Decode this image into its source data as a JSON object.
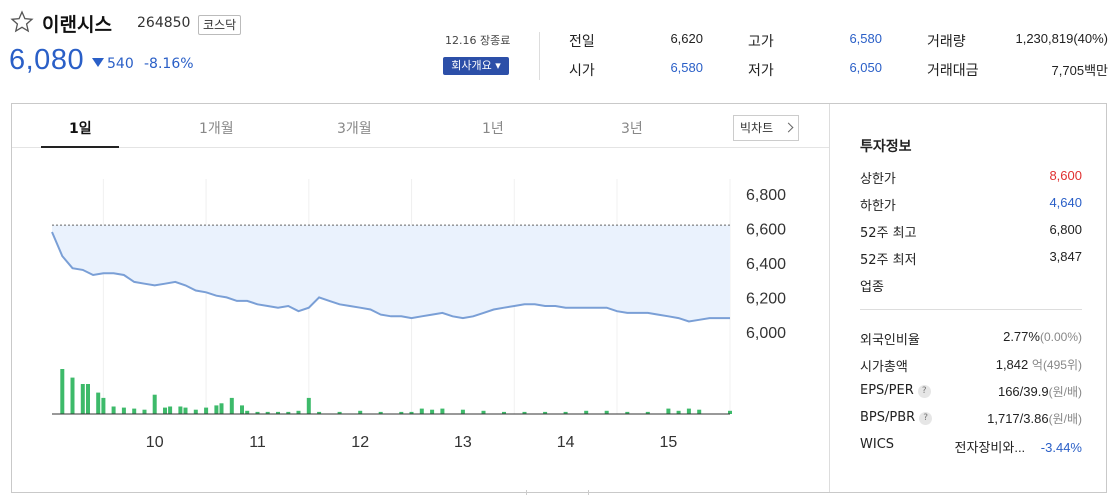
{
  "stock": {
    "name": "이랜시스",
    "code": "264850",
    "market": "코스닥",
    "price": "6,080",
    "change": "540",
    "change_rate": "-8.16%",
    "close_time": "12.16 장종료",
    "company_btn": "회사개요 ▾"
  },
  "quote": {
    "prev_label": "전일",
    "prev": "6,620",
    "high_label": "고가",
    "high": "6,580",
    "volume_label": "거래량",
    "volume": "1,230,819(40%)",
    "open_label": "시가",
    "open": "6,580",
    "low_label": "저가",
    "low": "6,050",
    "amount_label": "거래대금",
    "amount": "7,705백만"
  },
  "tabs": [
    "1일",
    "1개월",
    "3개월",
    "1년",
    "3년"
  ],
  "bigchart_label": "빅차트",
  "invest": {
    "title": "투자정보",
    "upper_label": "상한가",
    "upper": "8,600",
    "lower_label": "하한가",
    "lower": "4,640",
    "w52_high_label": "52주 최고",
    "w52_high": "6,800",
    "w52_low_label": "52주 최저",
    "w52_low": "3,847",
    "sector_label": "업종",
    "foreign_label": "외국인비율",
    "foreign": "2.77%",
    "foreign_sub": "(0.00%)",
    "mcap_label": "시가총액",
    "mcap": "1,842",
    "mcap_unit": "억",
    "mcap_sub": "(495위)",
    "eps_label": "EPS/PER",
    "eps": "166/39.9",
    "eps_unit": "(원/배)",
    "bps_label": "BPS/PBR",
    "bps": "1,717/3.86",
    "bps_unit": "(원/배)",
    "wics_label": "WICS",
    "wics": "전자장비와...",
    "wics_rate": "-3.44%",
    "help": "?"
  },
  "colors": {
    "up": "#e03030",
    "down": "#2a5fc7",
    "volume": "#3dba6a",
    "line": "#7a9fd6",
    "fill": "#eaf2fd"
  },
  "chart_data": {
    "type": "line",
    "y_ticks": [
      "6,800",
      "6,600",
      "6,400",
      "6,200",
      "6,000"
    ],
    "x_ticks": [
      "10",
      "11",
      "12",
      "13",
      "14",
      "15"
    ],
    "ylim": [
      5970,
      6830
    ],
    "prev_close": 6620,
    "price_t": [
      9.0,
      9.1,
      9.2,
      9.3,
      9.4,
      9.5,
      9.6,
      9.7,
      9.8,
      9.9,
      10.0,
      10.1,
      10.2,
      10.3,
      10.4,
      10.5,
      10.6,
      10.7,
      10.8,
      10.9,
      11.0,
      11.1,
      11.2,
      11.3,
      11.4,
      11.5,
      11.6,
      11.7,
      11.8,
      11.9,
      12.0,
      12.1,
      12.2,
      12.3,
      12.4,
      12.5,
      12.6,
      12.7,
      12.8,
      12.9,
      13.0,
      13.1,
      13.2,
      13.3,
      13.4,
      13.5,
      13.6,
      13.7,
      13.8,
      13.9,
      14.0,
      14.1,
      14.2,
      14.3,
      14.4,
      14.5,
      14.6,
      14.7,
      14.8,
      14.9,
      15.0,
      15.1,
      15.2,
      15.3,
      15.4,
      15.5,
      15.6
    ],
    "price": [
      6580,
      6440,
      6370,
      6360,
      6330,
      6340,
      6340,
      6330,
      6290,
      6280,
      6270,
      6280,
      6290,
      6270,
      6240,
      6230,
      6210,
      6200,
      6180,
      6180,
      6160,
      6150,
      6140,
      6150,
      6120,
      6140,
      6200,
      6180,
      6160,
      6150,
      6140,
      6130,
      6100,
      6090,
      6090,
      6080,
      6090,
      6100,
      6110,
      6090,
      6080,
      6090,
      6110,
      6130,
      6140,
      6150,
      6160,
      6160,
      6150,
      6150,
      6140,
      6140,
      6140,
      6140,
      6140,
      6120,
      6110,
      6110,
      6110,
      6100,
      6090,
      6080,
      6060,
      6070,
      6080,
      6080,
      6080
    ],
    "vol_t": [
      9.1,
      9.2,
      9.3,
      9.35,
      9.45,
      9.5,
      9.6,
      9.7,
      9.8,
      9.9,
      10.0,
      10.1,
      10.15,
      10.25,
      10.3,
      10.4,
      10.5,
      10.6,
      10.65,
      10.75,
      10.85,
      10.9,
      11.0,
      11.1,
      11.2,
      11.3,
      11.4,
      11.5,
      11.6,
      11.8,
      12.0,
      12.2,
      12.4,
      12.5,
      12.6,
      12.7,
      12.8,
      13.0,
      13.2,
      13.4,
      13.6,
      13.8,
      14.0,
      14.2,
      14.4,
      14.6,
      14.8,
      15.0,
      15.1,
      15.2,
      15.3,
      15.6
    ],
    "volume": [
      42,
      34,
      28,
      28,
      20,
      15,
      7,
      6,
      5,
      4,
      18,
      6,
      7,
      7,
      6,
      4,
      6,
      8,
      10,
      15,
      8,
      3,
      2,
      2,
      2,
      2,
      3,
      15,
      2,
      2,
      3,
      2,
      2,
      2,
      5,
      4,
      5,
      4,
      3,
      2,
      2,
      2,
      2,
      3,
      3,
      2,
      2,
      5,
      3,
      5,
      4,
      3
    ]
  }
}
